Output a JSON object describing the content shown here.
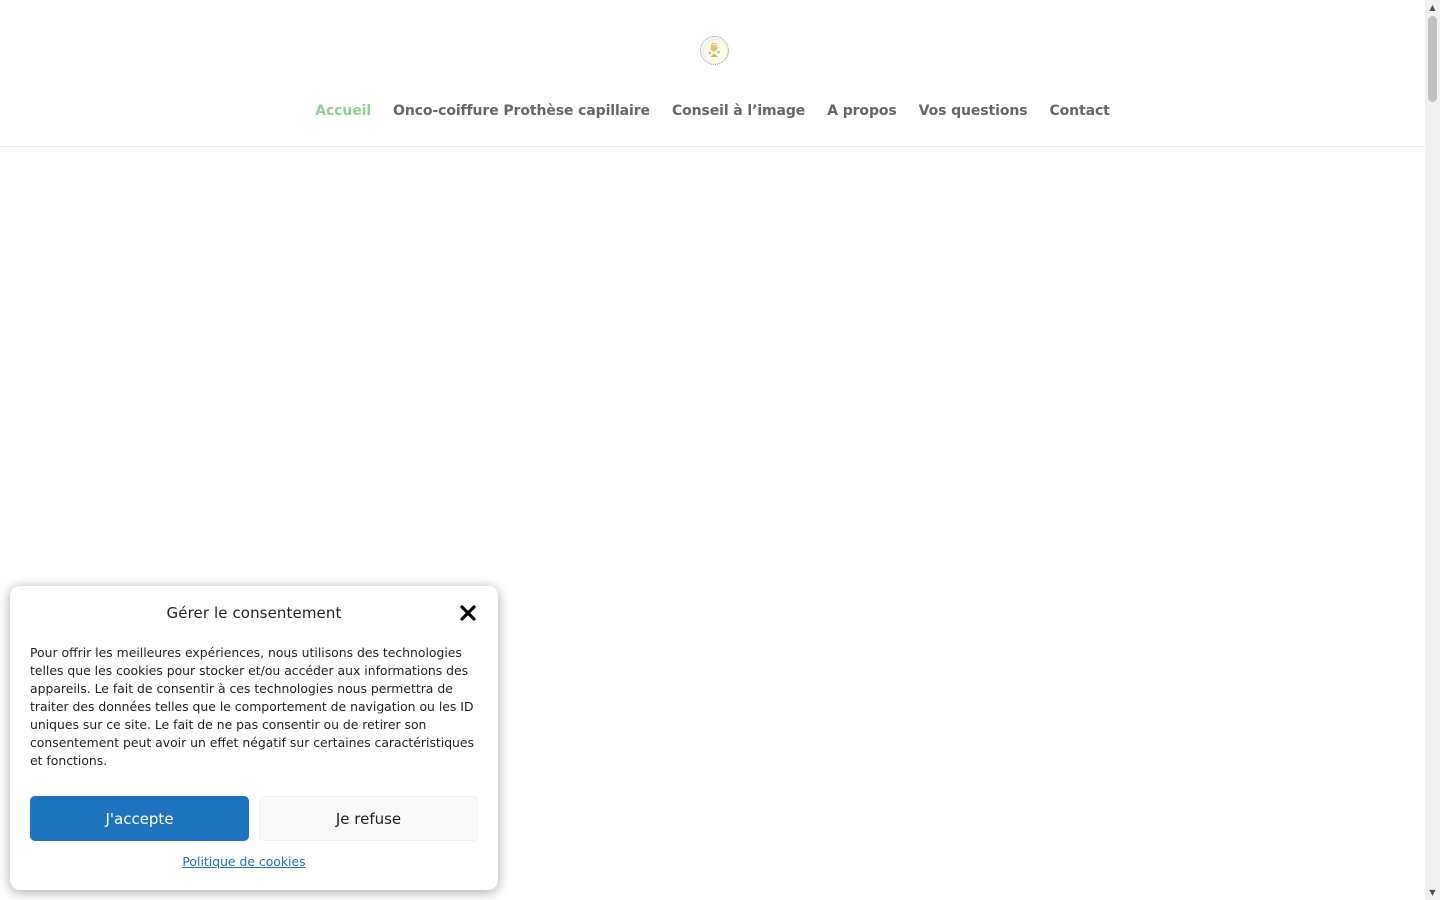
{
  "header": {
    "logo_icon": "portrait-logo-icon",
    "nav": [
      {
        "label": "Accueil",
        "active": true
      },
      {
        "label": "Onco-coiffure Prothèse capillaire",
        "active": false
      },
      {
        "label": "Conseil à l’image",
        "active": false
      },
      {
        "label": "A propos",
        "active": false
      },
      {
        "label": "Vos questions",
        "active": false
      },
      {
        "label": "Contact",
        "active": false
      }
    ],
    "active_color": "#8fcf9a",
    "nav_color": "#666666"
  },
  "consent": {
    "title": "Gérer le consentement",
    "close_icon": "close-icon",
    "text": "Pour offrir les meilleures expériences, nous utilisons des technologies telles que les cookies pour stocker et/ou accéder aux informations des appareils. Le fait de consentir à ces technologies nous permettra de traiter des données telles que le comportement de navigation ou les ID uniques sur ce site. Le fait de ne pas consentir ou de retirer son consentement peut avoir un effet négatif sur certaines caractéristiques et fonctions.",
    "accept_label": "J'accepte",
    "refuse_label": "Je refuse",
    "policy_label": "Politique de cookies",
    "accept_color": "#1e73be"
  }
}
